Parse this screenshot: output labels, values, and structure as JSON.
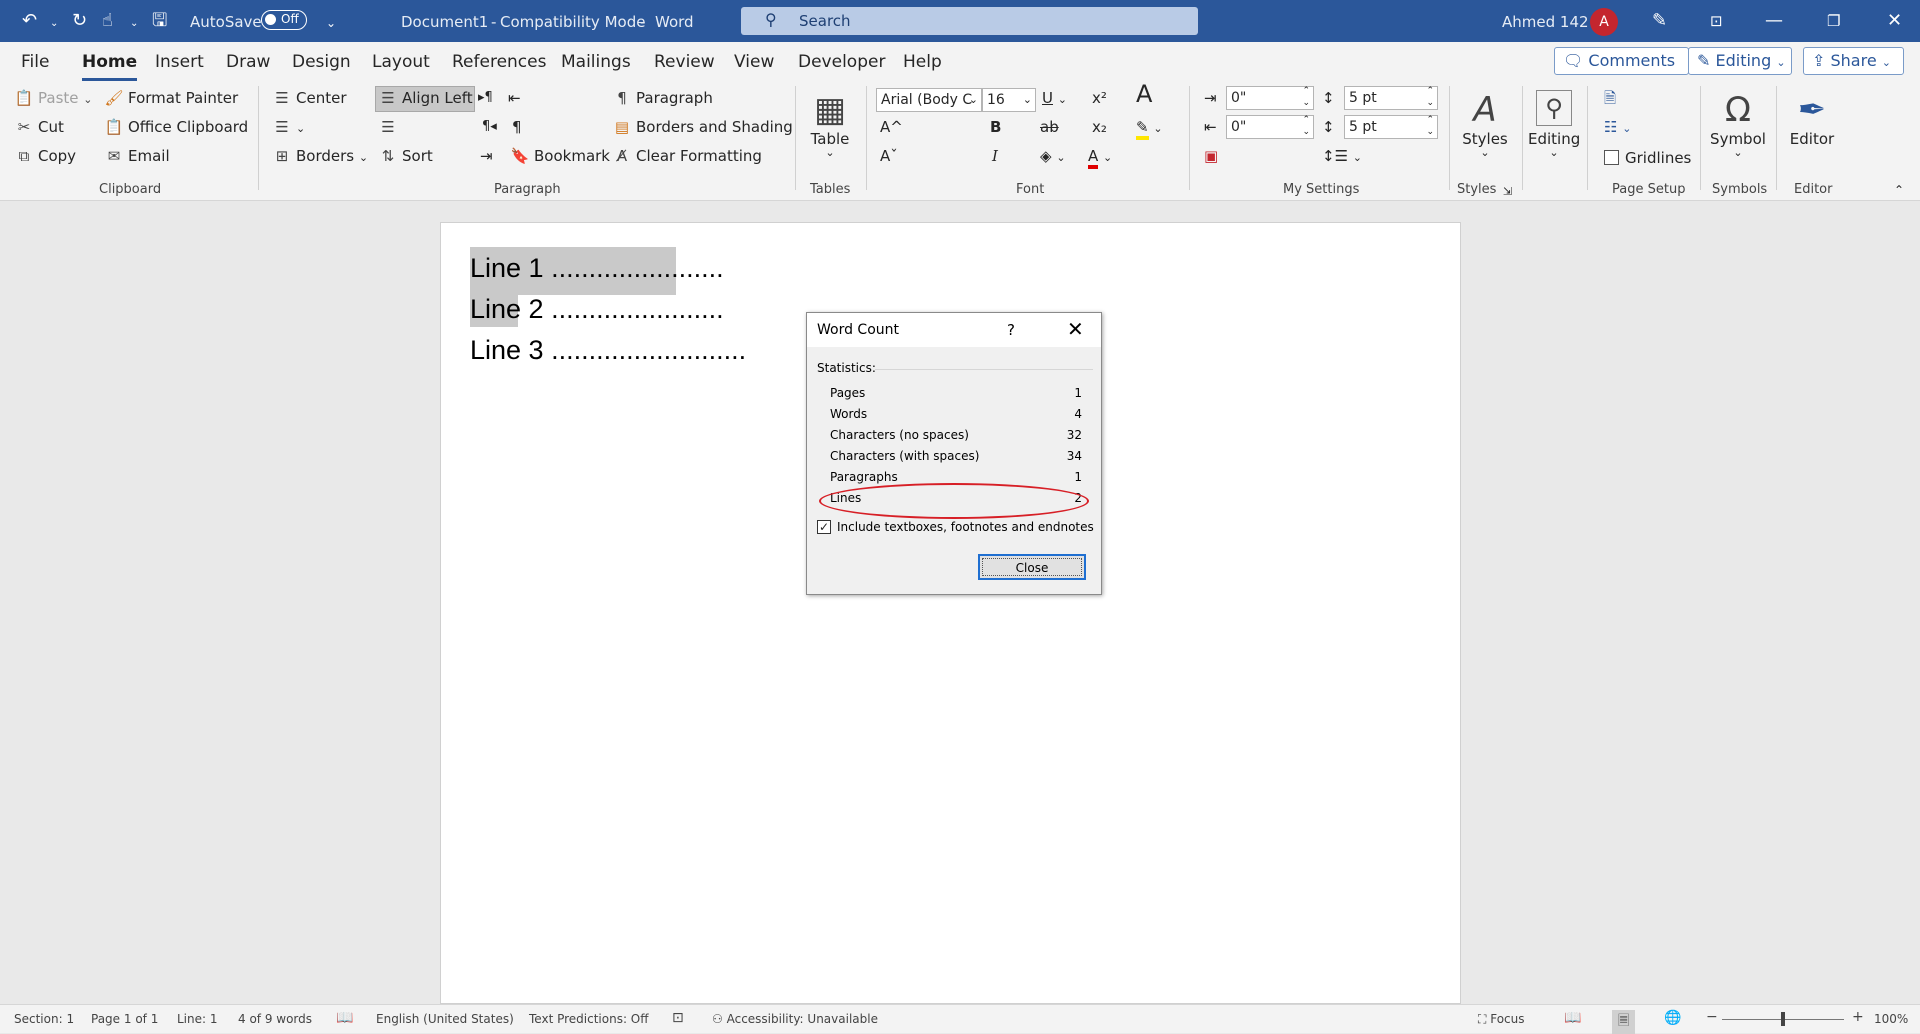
{
  "titlebar": {
    "autosave_label": "AutoSave",
    "autosave_state": "Off",
    "doc_name": "Document1",
    "mode": "Compatibility Mode",
    "sep1": "-",
    "sep2": "-",
    "app": "Word",
    "search_placeholder": "Search",
    "user_name": "Ahmed 142",
    "avatar_initial": "A"
  },
  "tabs": [
    "File",
    "Home",
    "Insert",
    "Draw",
    "Design",
    "Layout",
    "References",
    "Mailings",
    "Review",
    "View",
    "Developer",
    "Help"
  ],
  "active_tab": "Home",
  "tab_buttons": {
    "comments": "Comments",
    "editing": "Editing",
    "share": "Share"
  },
  "ribbon": {
    "clipboard": {
      "paste": "Paste",
      "cut": "Cut",
      "copy": "Copy",
      "format_painter": "Format Painter",
      "office_clipboard": "Office Clipboard",
      "email": "Email",
      "group": "Clipboard"
    },
    "paragraph": {
      "center": "Center",
      "align_left": "Align Left",
      "borders": "Borders",
      "sort": "Sort",
      "paragraph": "Paragraph",
      "borders_shading": "Borders and Shading",
      "bookmark": "Bookmark",
      "clear_formatting": "Clear Formatting",
      "group": "Paragraph"
    },
    "tables": {
      "table": "Table",
      "group": "Tables"
    },
    "font": {
      "font_name": "Arial (Body C",
      "font_size": "16",
      "group": "Font"
    },
    "my_settings": {
      "indent_left": "0\"",
      "indent_right": "0\"",
      "space_before": "5 pt",
      "space_after": "5 pt",
      "group": "My Settings"
    },
    "styles": {
      "label": "Styles",
      "group": "Styles"
    },
    "editing": {
      "label": "Editing"
    },
    "page_setup": {
      "gridlines": "Gridlines",
      "group": "Page Setup"
    },
    "symbols": {
      "label": "Symbol",
      "group": "Symbols"
    },
    "editor": {
      "label": "Editor",
      "group": "Editor"
    }
  },
  "document": {
    "lines": [
      "Line 1 .......................",
      "Line 2 .......................",
      "Line 3 .........................."
    ]
  },
  "word_count_dialog": {
    "title": "Word Count",
    "help": "?",
    "statistics_label": "Statistics:",
    "rows": [
      {
        "label": "Pages",
        "value": "1"
      },
      {
        "label": "Words",
        "value": "4"
      },
      {
        "label": "Characters (no spaces)",
        "value": "32"
      },
      {
        "label": "Characters (with spaces)",
        "value": "34"
      },
      {
        "label": "Paragraphs",
        "value": "1"
      },
      {
        "label": "Lines",
        "value": "2"
      }
    ],
    "include_label": "Include textboxes, footnotes and endnotes",
    "include_checked": true,
    "close_label": "Close",
    "annotation_color": "#d71f26"
  },
  "statusbar": {
    "section": "Section: 1",
    "page": "Page 1 of 1",
    "line": "Line: 1",
    "words": "4 of 9 words",
    "language": "English (United States)",
    "text_predictions": "Text Predictions: Off",
    "accessibility": "Accessibility: Unavailable",
    "focus": "Focus",
    "zoom": "100%"
  },
  "colors": {
    "titlebar": "#2b579a",
    "ribbon": "#f3f3f3",
    "canvas": "#e9e9e9"
  }
}
